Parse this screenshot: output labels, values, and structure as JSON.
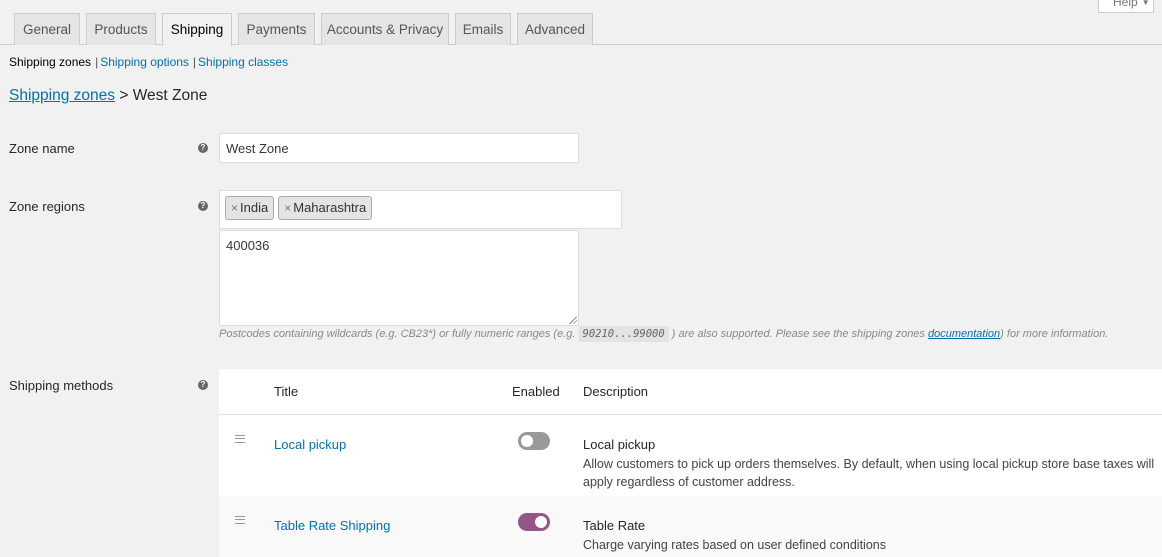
{
  "help": {
    "label": "Help"
  },
  "tabs": [
    {
      "label": "General"
    },
    {
      "label": "Products"
    },
    {
      "label": "Shipping"
    },
    {
      "label": "Payments"
    },
    {
      "label": "Accounts & Privacy"
    },
    {
      "label": "Emails"
    },
    {
      "label": "Advanced"
    }
  ],
  "subnav": {
    "zones": "Shipping zones",
    "options": "Shipping options",
    "classes": "Shipping classes"
  },
  "breadcrumb": {
    "link": "Shipping zones",
    "separator": ">",
    "current": "West Zone"
  },
  "zone_name": {
    "label": "Zone name",
    "value": "West Zone"
  },
  "zone_regions": {
    "label": "Zone regions",
    "chips": [
      "India",
      "Maharashtra"
    ],
    "postcodes": "400036",
    "description_prefix": "Postcodes containing wildcards (e.g. CB23*) or fully numeric ranges (e.g.",
    "description_code": "90210...99000",
    "description_middle": ") are also supported. Please see the shipping zones",
    "description_link": "documentation",
    "description_suffix": ") for more information."
  },
  "shipping_methods": {
    "label": "Shipping methods",
    "headers": {
      "title": "Title",
      "enabled": "Enabled",
      "description": "Description"
    },
    "rows": [
      {
        "title": "Local pickup",
        "enabled": false,
        "desc_title": "Local pickup",
        "desc_text": "Allow customers to pick up orders themselves. By default, when using local pickup store base taxes will apply regardless of customer address."
      },
      {
        "title": "Table Rate Shipping",
        "enabled": true,
        "desc_title": "Table Rate",
        "desc_text": "Charge varying rates based on user defined conditions"
      }
    ]
  }
}
